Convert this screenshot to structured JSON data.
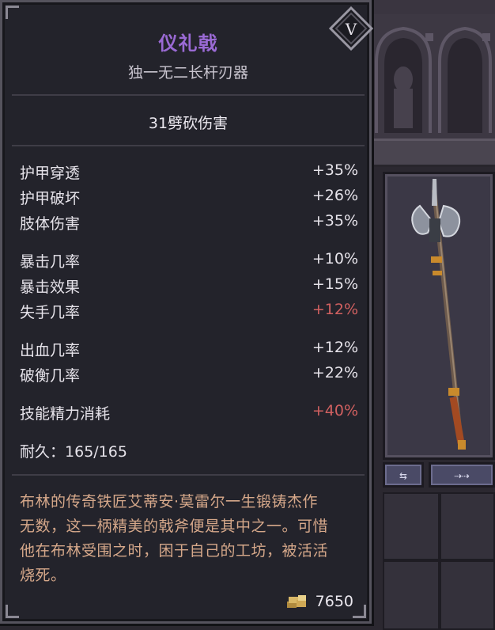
{
  "item": {
    "name": "仪礼戟",
    "type_line": "独一无二长杆刃器",
    "tier_badge": "V",
    "damage": "31劈砍伤害",
    "stat_groups": [
      [
        {
          "label": "护甲穿透",
          "value": "+35%",
          "negative": false
        },
        {
          "label": "护甲破坏",
          "value": "+26%",
          "negative": false
        },
        {
          "label": "肢体伤害",
          "value": "+35%",
          "negative": false
        }
      ],
      [
        {
          "label": "暴击几率",
          "value": "+10%",
          "negative": false
        },
        {
          "label": "暴击效果",
          "value": "+15%",
          "negative": false
        },
        {
          "label": "失手几率",
          "value": "+12%",
          "negative": true
        }
      ],
      [
        {
          "label": "出血几率",
          "value": "+12%",
          "negative": false
        },
        {
          "label": "破衡几率",
          "value": "+22%",
          "negative": false
        }
      ],
      [
        {
          "label": "技能精力消耗",
          "value": "+40%",
          "negative": true
        }
      ]
    ],
    "durability_label": "耐久：",
    "durability_value": "165/165",
    "lore_lines": [
      "布林的传奇铁匠艾蒂安·莫雷尔一生锻铸杰作",
      "无数，这一柄精美的戟斧便是其中之一。可惜",
      "他在布林受围之时，困于自己的工坊，被活活",
      "烧死。"
    ],
    "price": "7650",
    "price_icon": "gold-coins-icon"
  },
  "colors": {
    "name": "#9a6ad4",
    "text": "#e6e3ea",
    "negative": "#d06060",
    "lore": "#d6a88a",
    "panel_bg": "#23232b"
  },
  "slot": {
    "weapon_icon": "halberd-icon",
    "buttons": [
      {
        "icon": "swap-weapon-icon",
        "label": "⇆"
      },
      {
        "icon": "transfer-arrow-icon",
        "label": "⇢⇢"
      }
    ]
  }
}
